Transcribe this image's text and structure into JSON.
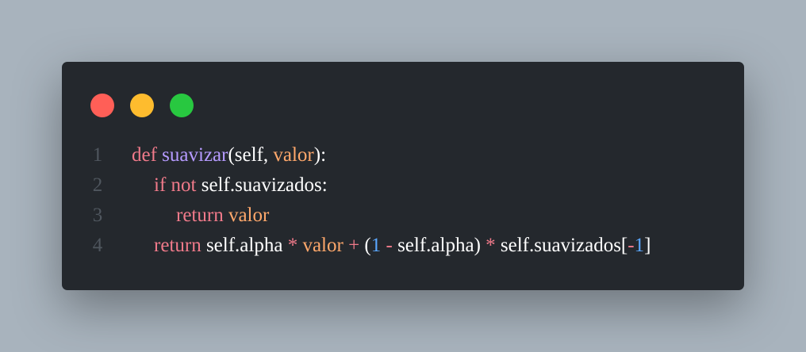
{
  "window": {
    "traffic_lights": [
      {
        "name": "close",
        "color": "#ff5f57"
      },
      {
        "name": "minimize",
        "color": "#febc2e"
      },
      {
        "name": "zoom",
        "color": "#28c840"
      }
    ]
  },
  "colors": {
    "keyword": "#f07a8a",
    "function": "#b69bff",
    "plain": "#ffffff",
    "param": "#ffa86b",
    "number": "#5aa7ff",
    "line_number": "#4f565e"
  },
  "code": {
    "lines": [
      {
        "number": "1",
        "indent": 0,
        "tokens": [
          {
            "text": "def ",
            "type": "keyword"
          },
          {
            "text": "suavizar",
            "type": "function"
          },
          {
            "text": "(self, ",
            "type": "plain"
          },
          {
            "text": "valor",
            "type": "param"
          },
          {
            "text": "):",
            "type": "plain"
          }
        ]
      },
      {
        "number": "2",
        "indent": 1,
        "tokens": [
          {
            "text": "if not ",
            "type": "keyword"
          },
          {
            "text": "self.suavizados:",
            "type": "plain"
          }
        ]
      },
      {
        "number": "3",
        "indent": 2,
        "tokens": [
          {
            "text": "return ",
            "type": "keyword"
          },
          {
            "text": "valor",
            "type": "param"
          }
        ]
      },
      {
        "number": "4",
        "indent": 1,
        "tokens": [
          {
            "text": "return ",
            "type": "keyword"
          },
          {
            "text": "self.alpha ",
            "type": "plain"
          },
          {
            "text": "* ",
            "type": "keyword"
          },
          {
            "text": "valor ",
            "type": "param"
          },
          {
            "text": "+ ",
            "type": "keyword"
          },
          {
            "text": "(",
            "type": "plain"
          },
          {
            "text": "1 ",
            "type": "number"
          },
          {
            "text": "- ",
            "type": "keyword"
          },
          {
            "text": "self.alpha) ",
            "type": "plain"
          },
          {
            "text": "* ",
            "type": "keyword"
          },
          {
            "text": "self.suavizados[",
            "type": "plain"
          },
          {
            "text": "-",
            "type": "keyword"
          },
          {
            "text": "1",
            "type": "number"
          },
          {
            "text": "]",
            "type": "plain"
          }
        ]
      }
    ]
  }
}
